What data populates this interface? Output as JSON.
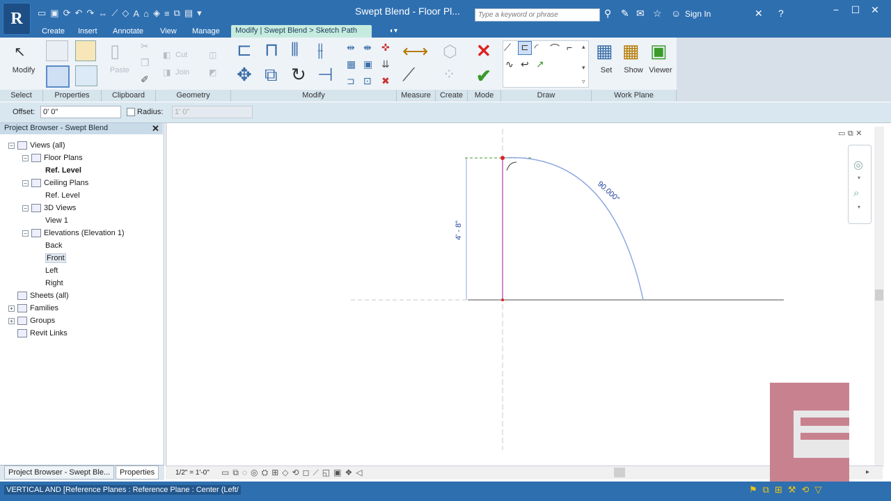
{
  "window": {
    "title": "Swept Blend - Floor Pl...",
    "search_placeholder": "Type a keyword or phrase",
    "signin": "Sign In"
  },
  "tabs": [
    "Create",
    "Insert",
    "Annotate",
    "View",
    "Manage"
  ],
  "active_tab": "Modify | Swept Blend > Sketch Path",
  "ribbon": {
    "select": {
      "modify": "Modify",
      "label": "Select"
    },
    "properties": {
      "label": "Properties"
    },
    "clipboard": {
      "paste": "Paste",
      "label": "Clipboard"
    },
    "geometry": {
      "cut": "Cut",
      "join": "Join",
      "label": "Geometry"
    },
    "modify": {
      "label": "Modify"
    },
    "measure": {
      "label": "Measure"
    },
    "create": {
      "label": "Create"
    },
    "mode": {
      "label": "Mode"
    },
    "draw": {
      "label": "Draw"
    },
    "workplane": {
      "set": "Set",
      "show": "Show",
      "viewer": "Viewer",
      "label": "Work Plane"
    }
  },
  "options": {
    "offset_label": "Offset:",
    "offset_value": "0'  0\"",
    "radius_label": "Radius:",
    "radius_value": "1'  0\""
  },
  "browser": {
    "title": "Project Browser - Swept Blend",
    "nodes": [
      {
        "label": "Views (all)",
        "level": 0,
        "toggle": "−"
      },
      {
        "label": "Floor Plans",
        "level": 1,
        "toggle": "−"
      },
      {
        "label": "Ref. Level",
        "level": 2,
        "bold": true
      },
      {
        "label": "Ceiling Plans",
        "level": 1,
        "toggle": "−"
      },
      {
        "label": "Ref. Level",
        "level": 2
      },
      {
        "label": "3D Views",
        "level": 1,
        "toggle": "−"
      },
      {
        "label": "View 1",
        "level": 2
      },
      {
        "label": "Elevations (Elevation 1)",
        "level": 1,
        "toggle": "−"
      },
      {
        "label": "Back",
        "level": 2
      },
      {
        "label": "Front",
        "level": 2,
        "selected": true
      },
      {
        "label": "Left",
        "level": 2
      },
      {
        "label": "Right",
        "level": 2
      },
      {
        "label": "Sheets (all)",
        "level": 0
      },
      {
        "label": "Families",
        "level": 0,
        "toggle": "+"
      },
      {
        "label": "Groups",
        "level": 0,
        "toggle": "+"
      },
      {
        "label": "Revit Links",
        "level": 0
      }
    ],
    "tabs": [
      "Project Browser - Swept Ble...",
      "Properties"
    ]
  },
  "canvas": {
    "dim_vertical": "4' - 8\"",
    "dim_arc": "90.000°"
  },
  "view_control": {
    "scale": "1/2\" = 1'-0\""
  },
  "status": {
    "text": "VERTICAL AND [Reference Planes : Reference Plane : Center (Left/"
  },
  "colors": {
    "titlebar": "#2e6fb0",
    "active_tab": "#c7eadf",
    "sketch_line": "#8fa8e0",
    "ref_plane": "#c060c0"
  }
}
